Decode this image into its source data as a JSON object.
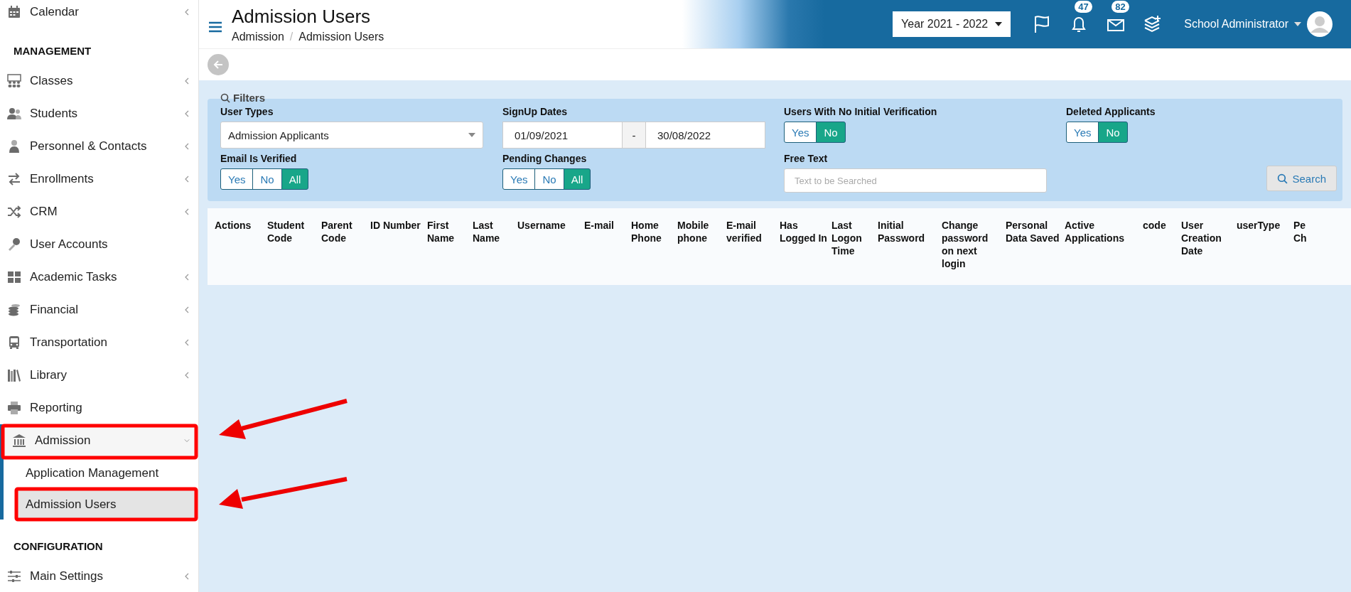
{
  "sidebar": {
    "groups": [
      {
        "items": [
          {
            "label": "Calendar",
            "expandable": true,
            "expanded": false
          }
        ]
      },
      {
        "heading": "MANAGEMENT",
        "items": [
          {
            "label": "Classes",
            "expandable": true,
            "expanded": false
          },
          {
            "label": "Students",
            "expandable": true,
            "expanded": false
          },
          {
            "label": "Personnel & Contacts",
            "expandable": true,
            "expanded": false
          },
          {
            "label": "Enrollments",
            "expandable": true,
            "expanded": false
          },
          {
            "label": "CRM",
            "expandable": true,
            "expanded": false
          },
          {
            "label": "User Accounts",
            "expandable": false,
            "expanded": false
          },
          {
            "label": "Academic Tasks",
            "expandable": true,
            "expanded": false
          },
          {
            "label": "Financial",
            "expandable": true,
            "expanded": false
          },
          {
            "label": "Transportation",
            "expandable": true,
            "expanded": false
          },
          {
            "label": "Library",
            "expandable": true,
            "expanded": false
          },
          {
            "label": "Reporting",
            "expandable": false,
            "expanded": false
          },
          {
            "label": "Admission",
            "expandable": true,
            "expanded": true,
            "children": [
              {
                "label": "Application Management",
                "selected": false
              },
              {
                "label": "Admission Users",
                "selected": true
              }
            ]
          }
        ]
      },
      {
        "heading": "CONFIGURATION",
        "items": [
          {
            "label": "Main Settings",
            "expandable": true,
            "expanded": false
          }
        ]
      }
    ]
  },
  "header": {
    "title": "Admission Users",
    "breadcrumb": [
      "Admission",
      "Admission Users"
    ],
    "breadcrumb_separator": "/",
    "year_select": "Year 2021 - 2022",
    "notifications": "47",
    "messages": "82",
    "user_name": "School Administrator"
  },
  "filters": {
    "label": "Filters",
    "fields": [
      {
        "kind": "select",
        "label": "User Types",
        "value": "Admission Applicants"
      },
      {
        "kind": "date_range",
        "label": "SignUp Dates",
        "from": "01/09/2021",
        "separator": "-",
        "to": "30/08/2022"
      },
      {
        "kind": "toggle",
        "label": "Users With No Initial Verification",
        "options": [
          {
            "label": "Yes",
            "selected": false
          },
          {
            "label": "No",
            "selected": true
          }
        ]
      },
      {
        "kind": "toggle",
        "label": "Deleted Applicants",
        "options": [
          {
            "label": "Yes",
            "selected": false
          },
          {
            "label": "No",
            "selected": true
          }
        ]
      },
      {
        "kind": "toggle",
        "label": "Email Is Verified",
        "options": [
          {
            "label": "Yes",
            "selected": false
          },
          {
            "label": "No",
            "selected": false
          },
          {
            "label": "All",
            "selected": true
          }
        ]
      },
      {
        "kind": "toggle",
        "label": "Pending Changes",
        "options": [
          {
            "label": "Yes",
            "selected": false
          },
          {
            "label": "No",
            "selected": false
          },
          {
            "label": "All",
            "selected": true
          }
        ]
      },
      {
        "kind": "text",
        "label": "Free Text",
        "placeholder": "Text to be Searched"
      }
    ],
    "search_button": "Search"
  },
  "table": {
    "columns": [
      "Actions",
      "Student Code",
      "Parent Code",
      "ID Number",
      "First Name",
      "Last Name",
      "Username",
      "E-mail",
      "Home Phone",
      "Mobile phone",
      "E-mail verified",
      "Has Logged In",
      "Last Logon Time",
      "Initial Password",
      "Change password on next login",
      "Personal Data Saved",
      "Active Applications",
      "code",
      "User Creation Date",
      "userType",
      "Pe Ch"
    ]
  }
}
